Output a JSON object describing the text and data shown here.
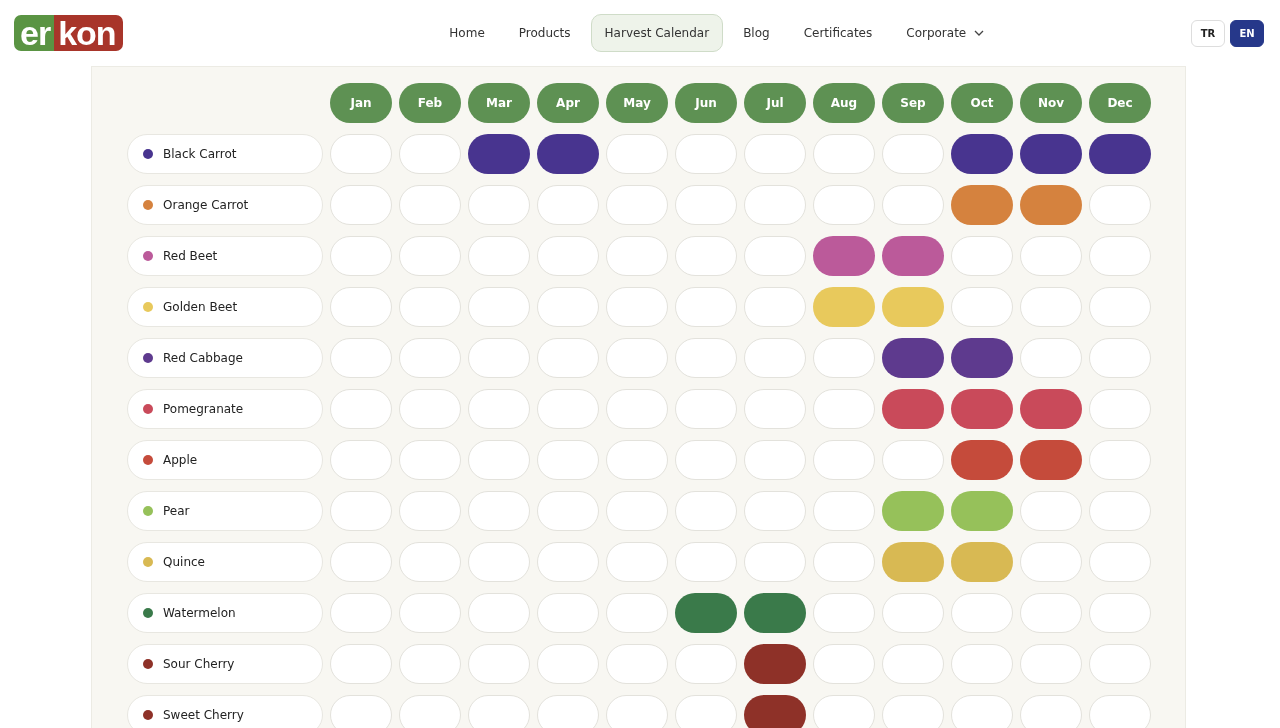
{
  "logo": {
    "left": "er",
    "right": "kon"
  },
  "nav": [
    {
      "label": "Home",
      "selected": false
    },
    {
      "label": "Products",
      "selected": false
    },
    {
      "label": "Harvest Calendar",
      "selected": true
    },
    {
      "label": "Blog",
      "selected": false
    },
    {
      "label": "Certificates",
      "selected": false
    },
    {
      "label": "Corporate",
      "selected": false,
      "kind": "dropdown"
    }
  ],
  "languages": [
    {
      "label": "TR",
      "selected": false
    },
    {
      "label": "EN",
      "selected": true
    }
  ],
  "months": [
    "Jan",
    "Feb",
    "Mar",
    "Apr",
    "May",
    "Jun",
    "Jul",
    "Aug",
    "Sep",
    "Oct",
    "Nov",
    "Dec"
  ],
  "rows": [
    {
      "name": "Black Carrot",
      "color": "#48348f",
      "harvest": [
        false,
        false,
        true,
        true,
        false,
        false,
        false,
        false,
        false,
        true,
        true,
        true
      ]
    },
    {
      "name": "Orange Carrot",
      "color": "#d5823e",
      "harvest": [
        false,
        false,
        false,
        false,
        false,
        false,
        false,
        false,
        false,
        true,
        true,
        false
      ]
    },
    {
      "name": "Red Beet",
      "color": "#bb5a9a",
      "harvest": [
        false,
        false,
        false,
        false,
        false,
        false,
        false,
        true,
        true,
        false,
        false,
        false
      ]
    },
    {
      "name": "Golden Beet",
      "color": "#e8c95c",
      "harvest": [
        false,
        false,
        false,
        false,
        false,
        false,
        false,
        true,
        true,
        false,
        false,
        false
      ]
    },
    {
      "name": "Red Cabbage",
      "color": "#5e3a8e",
      "harvest": [
        false,
        false,
        false,
        false,
        false,
        false,
        false,
        false,
        true,
        true,
        false,
        false
      ]
    },
    {
      "name": "Pomegranate",
      "color": "#c94a5a",
      "harvest": [
        false,
        false,
        false,
        false,
        false,
        false,
        false,
        false,
        true,
        true,
        true,
        false
      ]
    },
    {
      "name": "Apple",
      "color": "#c54b3b",
      "harvest": [
        false,
        false,
        false,
        false,
        false,
        false,
        false,
        false,
        false,
        true,
        true,
        false
      ]
    },
    {
      "name": "Pear",
      "color": "#96c15a",
      "harvest": [
        false,
        false,
        false,
        false,
        false,
        false,
        false,
        false,
        true,
        true,
        false,
        false
      ]
    },
    {
      "name": "Quince",
      "color": "#d8b953",
      "harvest": [
        false,
        false,
        false,
        false,
        false,
        false,
        false,
        false,
        true,
        true,
        false,
        false
      ]
    },
    {
      "name": "Watermelon",
      "color": "#3a7a4a",
      "harvest": [
        false,
        false,
        false,
        false,
        false,
        true,
        true,
        false,
        false,
        false,
        false,
        false
      ]
    },
    {
      "name": "Sour Cherry",
      "color": "#8e3128",
      "harvest": [
        false,
        false,
        false,
        false,
        false,
        false,
        true,
        false,
        false,
        false,
        false,
        false
      ]
    },
    {
      "name": "Sweet Cherry",
      "color": "#8e3128",
      "harvest": [
        false,
        false,
        false,
        false,
        false,
        false,
        true,
        false,
        false,
        false,
        false,
        false
      ]
    }
  ]
}
